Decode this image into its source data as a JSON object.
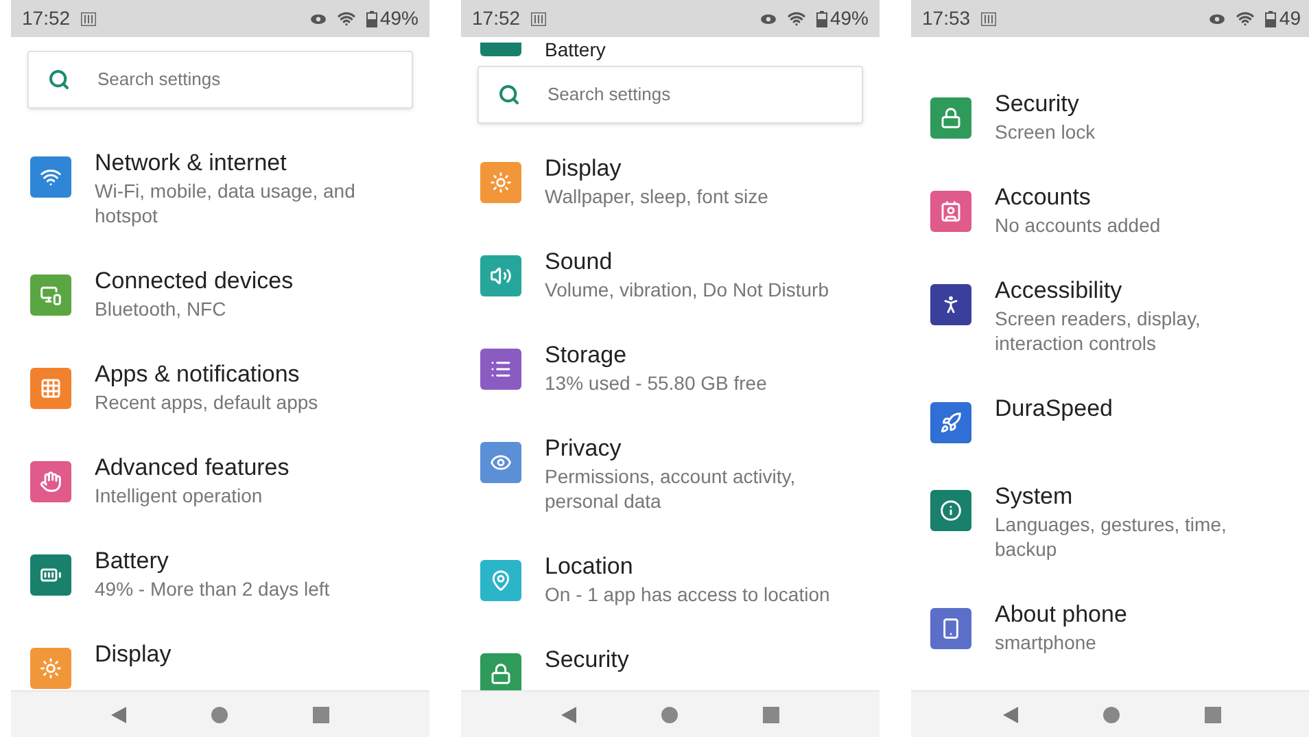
{
  "screens": [
    {
      "status": {
        "time": "17:52",
        "battery": "49%"
      },
      "search": {
        "placeholder": "Search settings"
      },
      "items": [
        {
          "kind": "wifi",
          "color": "#2f86d6",
          "title": "Network & internet",
          "subtitle": "Wi-Fi, mobile, data usage, and hotspot"
        },
        {
          "kind": "devices",
          "color": "#5aa642",
          "title": "Connected devices",
          "subtitle": "Bluetooth, NFC"
        },
        {
          "kind": "apps",
          "color": "#f2812e",
          "title": "Apps & notifications",
          "subtitle": "Recent apps, default apps"
        },
        {
          "kind": "hand",
          "color": "#e05a8a",
          "title": "Advanced features",
          "subtitle": "Intelligent operation"
        },
        {
          "kind": "battery",
          "color": "#19806b",
          "title": "Battery",
          "subtitle": "49% - More than 2 days left"
        },
        {
          "kind": "display",
          "color": "#f2963a",
          "title": "Display"
        }
      ]
    },
    {
      "status": {
        "time": "17:52",
        "battery": "49%"
      },
      "peek": {
        "kind": "battery",
        "color": "#19806b",
        "title": "Battery"
      },
      "search": {
        "placeholder": "Search settings"
      },
      "items": [
        {
          "kind": "display",
          "color": "#f2963a",
          "title": "Display",
          "subtitle": "Wallpaper, sleep, font size"
        },
        {
          "kind": "sound",
          "color": "#26a69a",
          "title": "Sound",
          "subtitle": "Volume, vibration, Do Not Disturb"
        },
        {
          "kind": "storage",
          "color": "#8a5cc2",
          "title": "Storage",
          "subtitle": "13% used - 55.80 GB free"
        },
        {
          "kind": "privacy",
          "color": "#5b8fd6",
          "title": "Privacy",
          "subtitle": "Permissions, account activity, personal data"
        },
        {
          "kind": "location",
          "color": "#2bb5c9",
          "title": "Location",
          "subtitle": "On - 1 app has access to location"
        },
        {
          "kind": "lock",
          "color": "#2e9b5a",
          "title": "Security"
        }
      ]
    },
    {
      "status": {
        "time": "17:53",
        "battery": "49"
      },
      "items": [
        {
          "kind": "lock",
          "color": "#2e9b5a",
          "title": "Security",
          "subtitle": "Screen lock"
        },
        {
          "kind": "account",
          "color": "#e05a8a",
          "title": "Accounts",
          "subtitle": "No accounts added"
        },
        {
          "kind": "accessibility",
          "color": "#3b3f9c",
          "title": "Accessibility",
          "subtitle": "Screen readers, display, interaction controls"
        },
        {
          "kind": "speed",
          "color": "#2f6fd6",
          "title": "DuraSpeed"
        },
        {
          "kind": "system",
          "color": "#19806b",
          "title": "System",
          "subtitle": "Languages, gestures, time, backup"
        },
        {
          "kind": "phone",
          "color": "#5b6fc9",
          "title": "About phone",
          "subtitle": "smartphone"
        }
      ]
    }
  ]
}
